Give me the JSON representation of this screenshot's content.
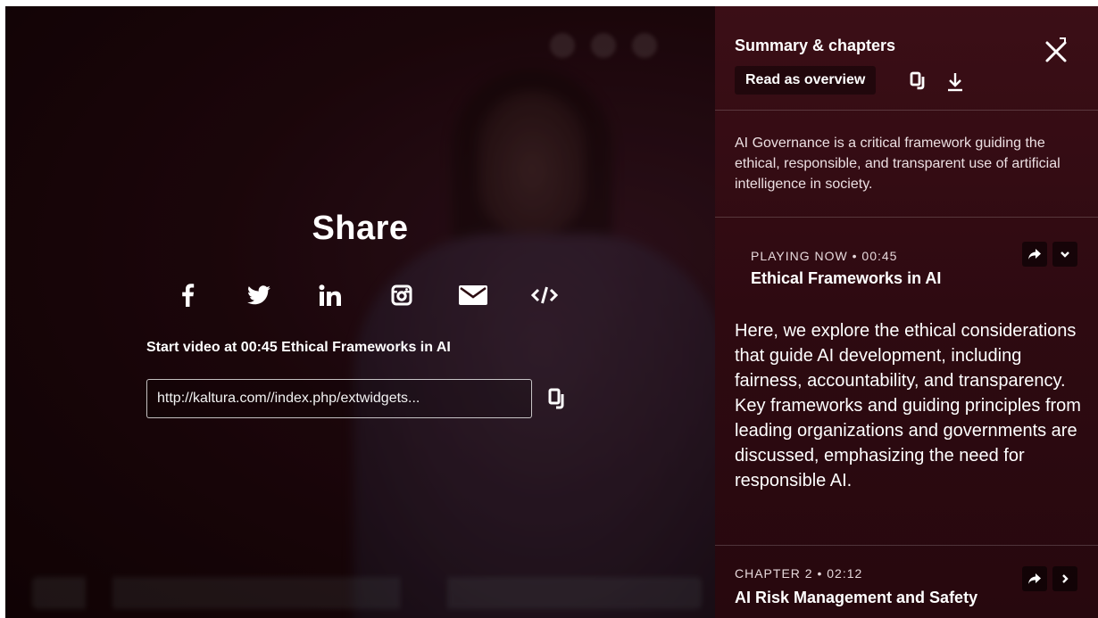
{
  "share": {
    "title": "Share",
    "social_icons": [
      "facebook-icon",
      "twitter-icon",
      "linkedin-icon",
      "instagram-icon",
      "email-icon",
      "embed-code-icon"
    ],
    "start_label": "Start video at 00:45 Ethical Frameworks in AI",
    "link_value": "http://kaltura.com//index.php/extwidgets...",
    "copy_icon": "copy-icon"
  },
  "panel": {
    "title": "Summary & chapters",
    "read_overview_label": "Read as overview",
    "overview_text": "AI Governance is a critical framework guiding the ethical, responsible, and transparent use of artificial intelligence in society.",
    "chapters": [
      {
        "meta": "PLAYING NOW • 00:45",
        "title": "Ethical Frameworks in AI",
        "description": "Here, we explore the ethical considerations that guide AI development, including fairness, accountability, and transparency. Key frameworks and guiding principles from leading organizations and governments are discussed, emphasizing the need for responsible AI.",
        "expanded": true
      },
      {
        "meta": "CHAPTER 2 • 02:12",
        "title": "AI Risk Management and Safety",
        "expanded": false
      }
    ]
  },
  "colors": {
    "panel_bg": "#2e0a11",
    "video_bg": "#26090f",
    "text": "#ffffff"
  }
}
